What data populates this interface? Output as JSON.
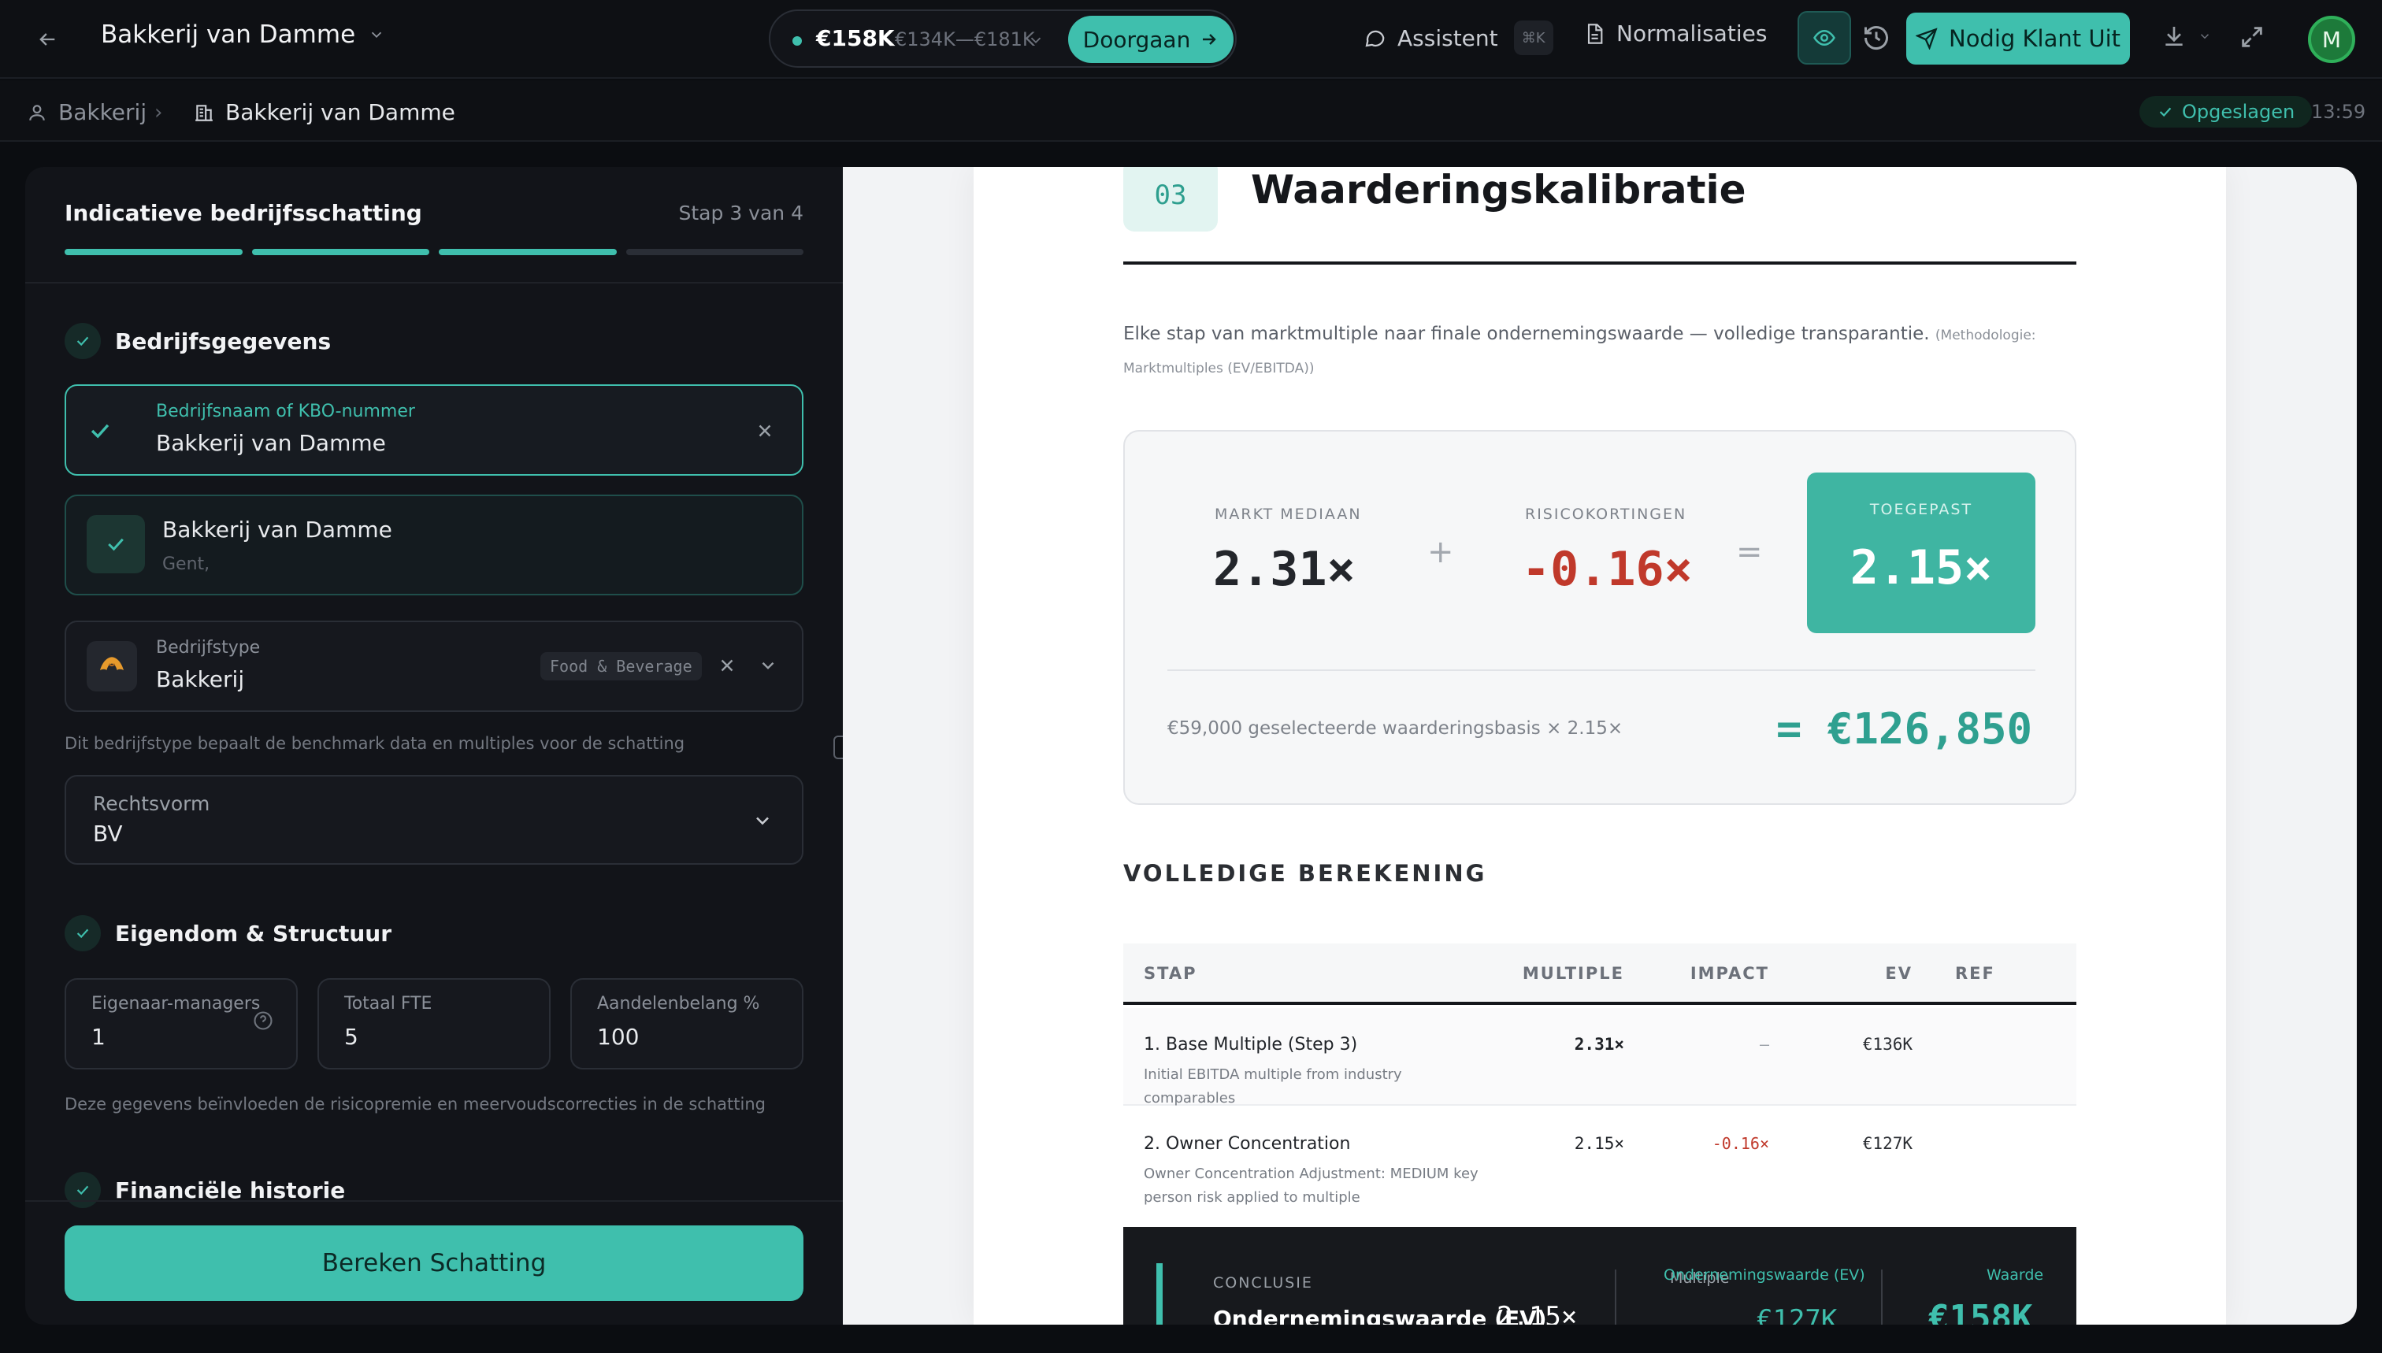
{
  "topbar": {
    "company": "Bakkerij van Damme",
    "estimate_value": "€158K",
    "estimate_range": "€134K—€181K",
    "continue_label": "Doorgaan",
    "assistant_label": "Assistent",
    "assistant_shortcut": "⌘K",
    "normalizations_label": "Normalisaties",
    "invite_label": "Nodig Klant Uit",
    "avatar_initial": "M"
  },
  "breadcrumb": {
    "root": "Bakkerij",
    "current": "Bakkerij van Damme",
    "saved_label": "Opgeslagen",
    "time": "13:59"
  },
  "left": {
    "title": "Indicatieve bedrijfsschatting",
    "step": "Stap 3 van 4",
    "progress": {
      "completed": 3,
      "total": 4
    },
    "section1": "Bedrijfsgegevens",
    "company_field": {
      "label": "Bedrijfsnaam of KBO-nummer",
      "value": "Bakkerij van Damme"
    },
    "match": {
      "name": "Bakkerij van Damme",
      "city": "Gent,"
    },
    "type_field": {
      "label": "Bedrijfstype",
      "value": "Bakkerij",
      "tag": "Food & Beverage",
      "hint": "Dit bedrijfstype bepaalt de benchmark data en multiples voor de schatting"
    },
    "legal_field": {
      "label": "Rechtsvorm",
      "value": "BV"
    },
    "section2": "Eigendom & Structuur",
    "owners": {
      "label": "Eigenaar-managers",
      "value": "1"
    },
    "fte": {
      "label": "Totaal FTE",
      "value": "5"
    },
    "shares": {
      "label": "Aandelenbelang %",
      "value": "100"
    },
    "structure_hint": "Deze gegevens beïnvloeden de risicopremie en meervoudscorrecties in de schatting",
    "section3": "Financiële historie",
    "calculate_label": "Bereken Schatting"
  },
  "doc": {
    "section_number": "03",
    "title": "Waarderingskalibratie",
    "intro": "Elke stap van marktmultiple naar finale ondernemingswaarde — volledige transparantie.",
    "intro_method": "(Methodologie: Marktmultiples (EV/EBITDA))",
    "calibration": {
      "market_label": "MARKT MEDIAAN",
      "market_value": "2.31×",
      "plus": "+",
      "risk_label": "RISICOKORTINGEN",
      "risk_value": "-0.16×",
      "equals": "=",
      "applied_label": "TOEGEPAST",
      "applied_value": "2.15×",
      "basis_text": "€59,000 geselecteerde waarderingsbasis × 2.15×",
      "total": "= €126,850"
    },
    "full_calc_title": "VOLLEDIGE BEREKENING",
    "table": {
      "headers": {
        "step": "STAP",
        "multiple": "MULTIPLE",
        "impact": "IMPACT",
        "ev": "EV",
        "ref": "REF"
      },
      "rows": [
        {
          "title": "1. Base Multiple (Step 3)",
          "sub": "Initial EBITDA multiple from industry comparables",
          "multiple": "2.31×",
          "impact": "—",
          "ev": "€136K"
        },
        {
          "title": "2. Owner Concentration",
          "sub": "Owner Concentration Adjustment: MEDIUM key person risk applied to multiple",
          "multiple": "2.15×",
          "impact": "-0.16×",
          "ev": "€127K"
        }
      ]
    },
    "conclusion": {
      "label": "CONCLUSIE",
      "name": "Ondernemingswaarde (EV)",
      "multiple_label": "Multiple",
      "multiple": "2.15×",
      "ev_label": "Ondernemingswaarde (EV)",
      "ev": "€127K",
      "value_label": "Waarde",
      "value": "€158K"
    }
  }
}
